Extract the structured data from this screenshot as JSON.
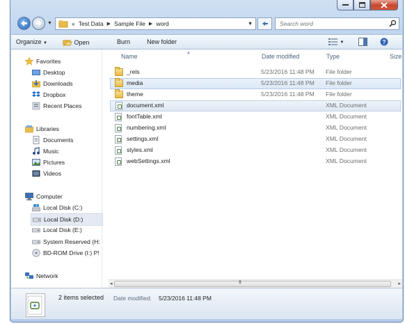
{
  "window": {
    "caption_buttons": [
      "minimize",
      "maximize",
      "close"
    ]
  },
  "address_bar": {
    "overflow": "«",
    "crumbs": [
      "Test Data",
      "Sample File",
      "word"
    ],
    "search_placeholder": "Search word"
  },
  "toolbar": {
    "organize": "Organize",
    "open": "Open",
    "burn": "Burn",
    "new_folder": "New folder"
  },
  "nav": {
    "favorites": "Favorites",
    "desktop": "Desktop",
    "downloads": "Downloads",
    "dropbox": "Dropbox",
    "recent": "Recent Places",
    "libraries": "Libraries",
    "documents": "Documents",
    "music": "Music",
    "pictures": "Pictures",
    "videos": "Videos",
    "computer": "Computer",
    "disk_c": "Local Disk (C:)",
    "disk_d": "Local Disk (D:)",
    "disk_e": "Local Disk (E:)",
    "system_reserved": "System Reserved (H:",
    "bdrom": "BD-ROM Drive (I:) P!",
    "network": "Network"
  },
  "columns": {
    "name": "Name",
    "date": "Date modified",
    "type": "Type",
    "size": "Size"
  },
  "files": [
    {
      "name": "_rels",
      "date": "5/23/2016 11:48 PM",
      "type": "File folder",
      "kind": "folder"
    },
    {
      "name": "media",
      "date": "5/23/2016 11:48 PM",
      "type": "File folder",
      "kind": "folder"
    },
    {
      "name": "theme",
      "date": "5/23/2016 11:48 PM",
      "type": "File folder",
      "kind": "folder"
    },
    {
      "name": "document.xml",
      "date": "",
      "type": "XML Document",
      "kind": "xml"
    },
    {
      "name": "fontTable.xml",
      "date": "",
      "type": "XML Document",
      "kind": "xml"
    },
    {
      "name": "numbering.xml",
      "date": "",
      "type": "XML Document",
      "kind": "xml"
    },
    {
      "name": "settings.xml",
      "date": "",
      "type": "XML Document",
      "kind": "xml"
    },
    {
      "name": "styles.xml",
      "date": "",
      "type": "XML Document",
      "kind": "xml"
    },
    {
      "name": "webSettings.xml",
      "date": "",
      "type": "XML Document",
      "kind": "xml"
    }
  ],
  "scrollbar": {
    "left_arrow": "◂",
    "right_arrow": "▸",
    "grip": "III"
  },
  "details": {
    "selection": "2 items selected",
    "date_label": "Date modified:",
    "date_value": "5/23/2016 11:48 PM"
  },
  "colors": {
    "selection_bg": "#dbe8f6",
    "window_frame": "#bcd3ee",
    "close_button": "#c7452d"
  }
}
